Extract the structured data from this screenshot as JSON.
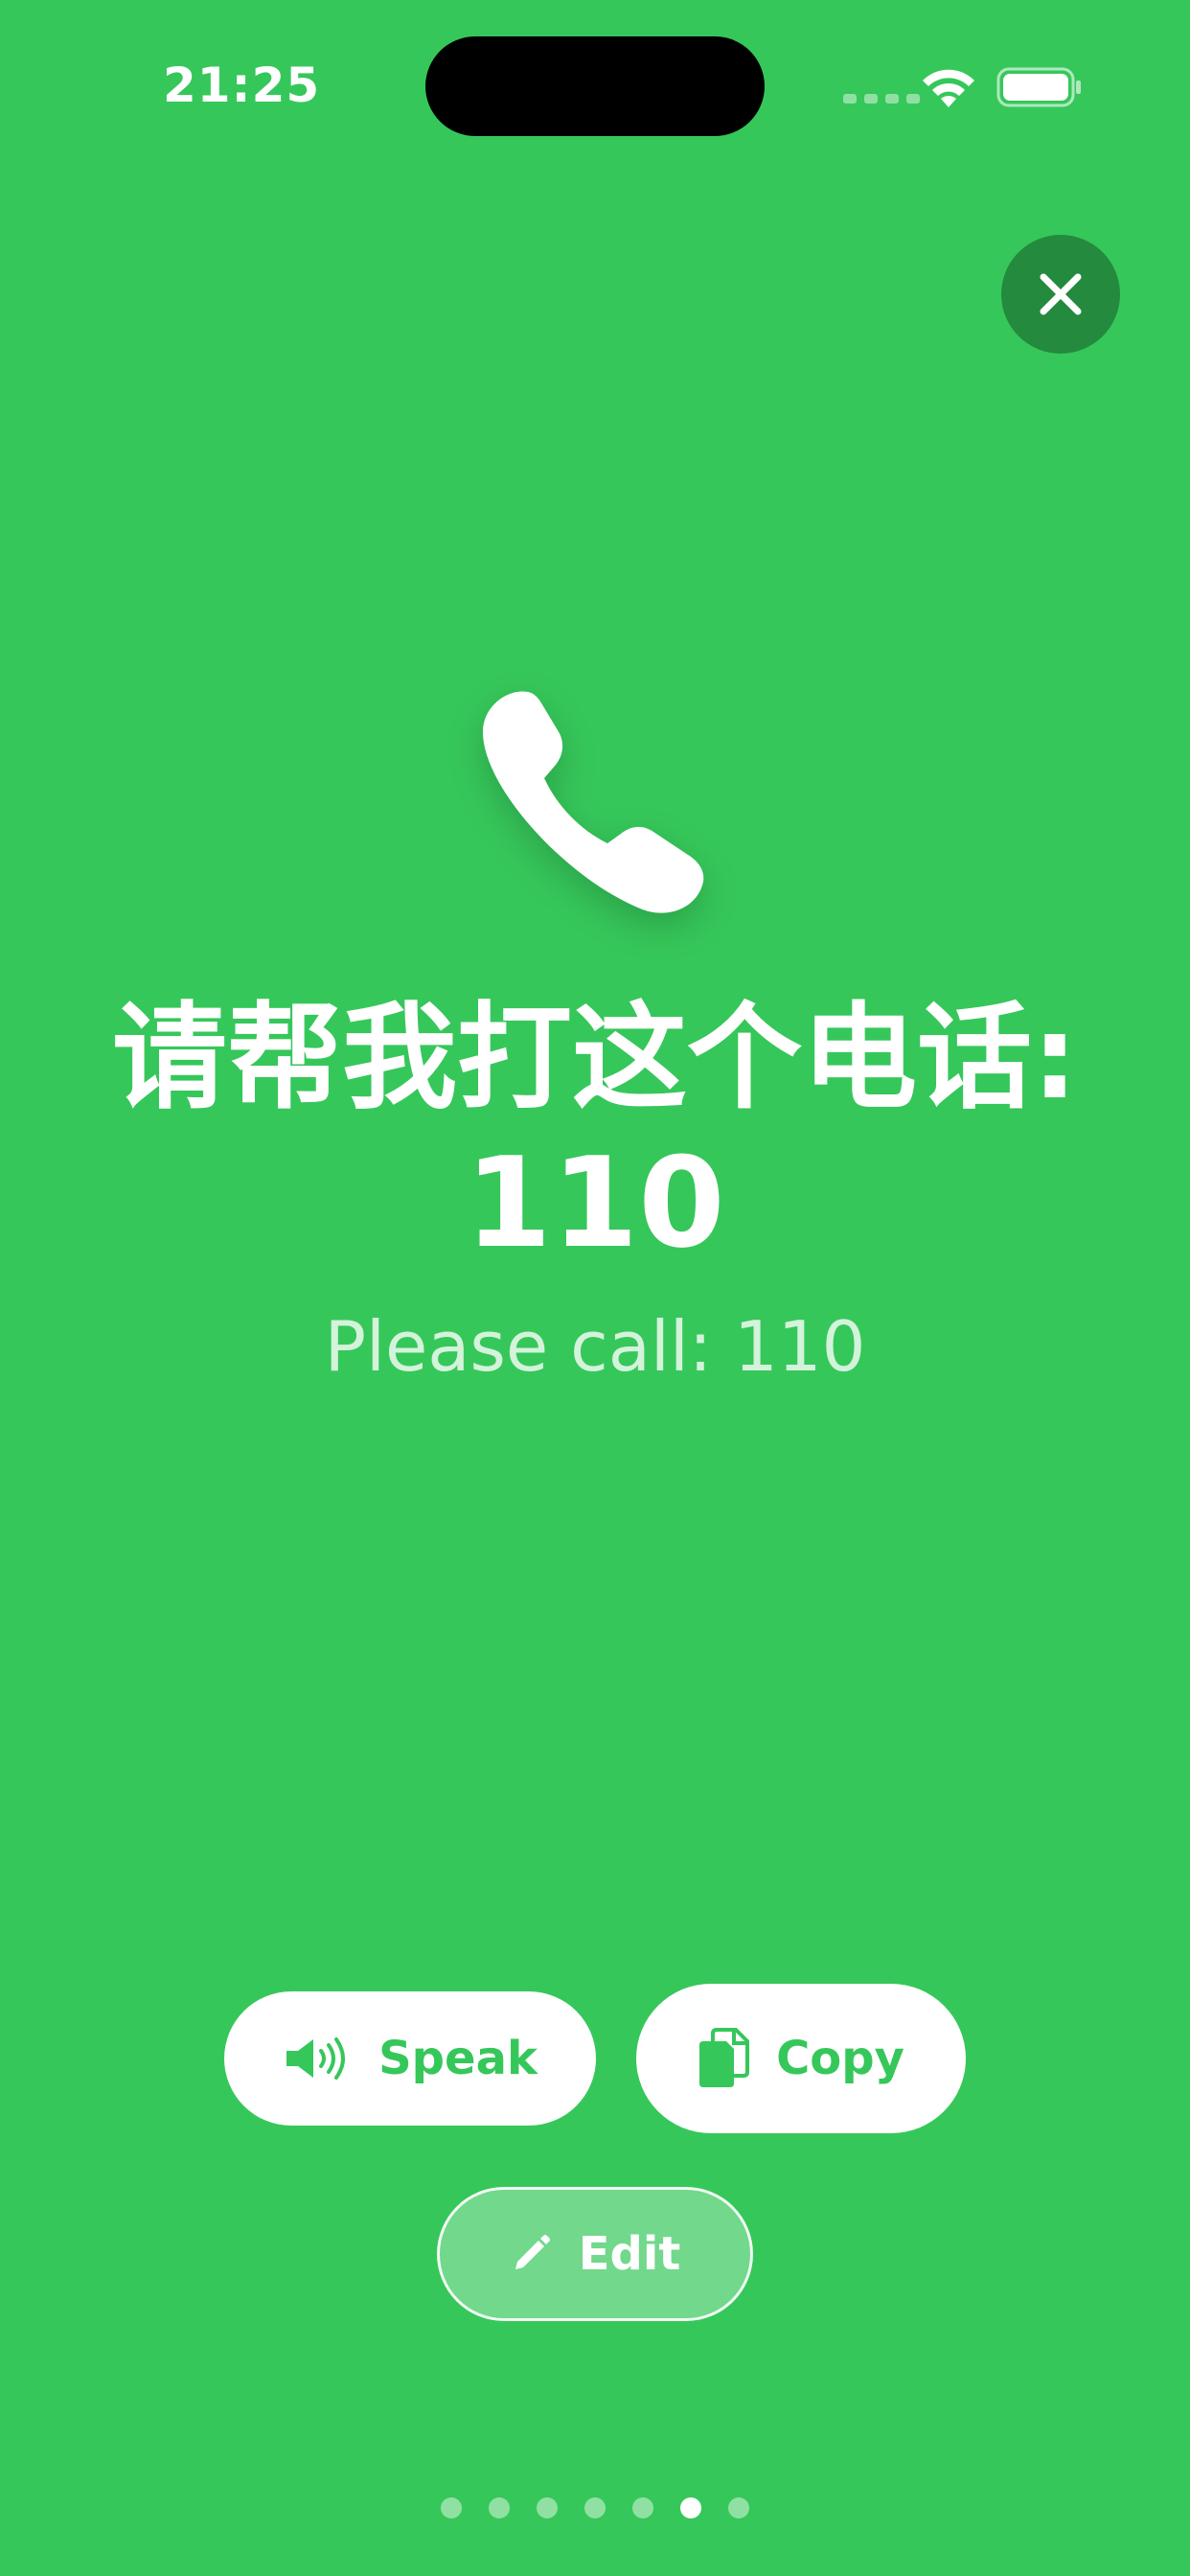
{
  "status_bar": {
    "time": "21:25",
    "wifi_icon": "wifi-icon",
    "battery_icon": "battery-icon"
  },
  "close_icon": "close-icon",
  "phone_icon": "phone-icon",
  "phrase": {
    "primary_line1": "请帮我打这个电话:",
    "primary_line2": "110",
    "translation": "Please call: 110"
  },
  "actions": {
    "speak_label": "Speak",
    "speak_icon": "speaker-icon",
    "copy_label": "Copy",
    "copy_icon": "copy-icon",
    "edit_label": "Edit",
    "edit_icon": "pencil-icon"
  },
  "pagination": {
    "total": 7,
    "current": 6
  },
  "colors": {
    "background": "#36c75a",
    "close_button": "#238a3e",
    "button_text": "#36c75a"
  }
}
